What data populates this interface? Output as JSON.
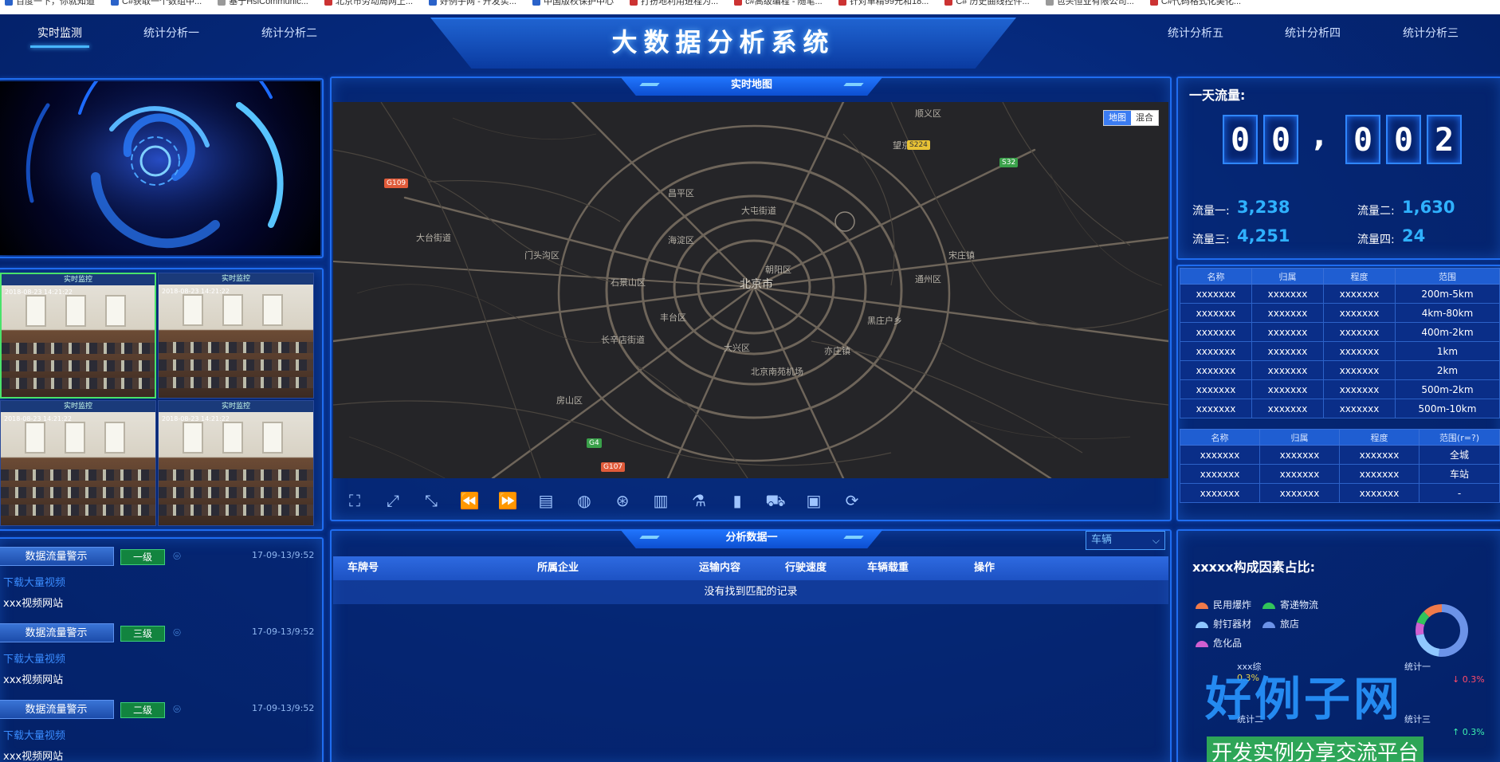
{
  "bookmarks": [
    "百度一下，你就知道",
    "C#获取一个数组中...",
    "基于HslCommunic...",
    "北京市劳动局网上...",
    "好例子网 - 开发实...",
    "中国版权保护中心",
    "打扮地利用进程为...",
    "c#高级编程 - 随笔...",
    "针对单精99元和18...",
    "C# 历史曲线控件...",
    "包头恒业有限公司...",
    "C#代码格式化美化..."
  ],
  "header": {
    "title": "大数据分析系统",
    "nav_left": [
      "实时监测",
      "统计分析一",
      "统计分析二"
    ],
    "nav_right": [
      "统计分析五",
      "统计分析四",
      "统计分析三"
    ]
  },
  "cameras": {
    "bar_label": "实时监控",
    "timestamp": "2018-08-23 14:21:22"
  },
  "alerts": [
    {
      "name": "数据流量警示",
      "level": "一级",
      "time": "17-09-13/9:52",
      "link": "下载大量视频",
      "site": "xxx视频网站"
    },
    {
      "name": "数据流量警示",
      "level": "三级",
      "time": "17-09-13/9:52",
      "link": "下载大量视频",
      "site": "xxx视频网站"
    },
    {
      "name": "数据流量警示",
      "level": "二级",
      "time": "17-09-13/9:52",
      "link": "下载大量视频",
      "site": "xxx视频网站"
    }
  ],
  "map": {
    "tab": "实时地图",
    "toggle": [
      "地图",
      "混合"
    ],
    "labels": {
      "center": "北京市",
      "l1": "昌平区",
      "l2": "海淀区",
      "l3": "朝阳区",
      "l4": "丰台区",
      "l5": "石景山区",
      "l6": "门头沟区",
      "l7": "通州区",
      "l8": "顺义区",
      "l9": "大兴区",
      "l10": "房山区",
      "l11": "长辛店街道",
      "l12": "大屯街道",
      "l13": "黑庄户乡",
      "l14": "北京南苑机场",
      "l15": "亦庄镇",
      "l16": "宋庄镇",
      "l17": "望京街道",
      "l18": "大台街道"
    },
    "roads": {
      "r1": "G109",
      "r2": "S224",
      "r3": "S32",
      "r4": "G4",
      "r5": "G107"
    }
  },
  "toolbar_icons": [
    "fullscreen-icon",
    "expand-icon",
    "collapse-icon",
    "rewind-icon",
    "forward-icon",
    "layers-icon",
    "globe-icon",
    "satellite-icon",
    "building-icon",
    "flask-icon",
    "chart-building-icon",
    "truck-icon",
    "window-icon",
    "refresh-icon"
  ],
  "analysis": {
    "tab": "分析数据一",
    "select_value": "车辆",
    "columns": [
      "车牌号",
      "所属企业",
      "运输内容",
      "行驶速度",
      "车辆载重",
      "操作"
    ],
    "empty": "没有找到匹配的记录"
  },
  "flow": {
    "title": "一天流量:",
    "digits": [
      "0",
      "0",
      "0",
      "0",
      "2"
    ],
    "sep": ",",
    "stats": [
      {
        "label": "流量一:",
        "value": "3,238"
      },
      {
        "label": "流量二:",
        "value": "1,630"
      },
      {
        "label": "流量三:",
        "value": "4,251"
      },
      {
        "label": "流量四:",
        "value": "24"
      }
    ]
  },
  "table1": {
    "headers": [
      "名称",
      "归属",
      "程度",
      "范围"
    ],
    "rows": [
      [
        "xxxxxxx",
        "xxxxxxx",
        "xxxxxxx",
        "200m-5km"
      ],
      [
        "xxxxxxx",
        "xxxxxxx",
        "xxxxxxx",
        "4km-80km"
      ],
      [
        "xxxxxxx",
        "xxxxxxx",
        "xxxxxxx",
        "400m-2km"
      ],
      [
        "xxxxxxx",
        "xxxxxxx",
        "xxxxxxx",
        "1km"
      ],
      [
        "xxxxxxx",
        "xxxxxxx",
        "xxxxxxx",
        "2km"
      ],
      [
        "xxxxxxx",
        "xxxxxxx",
        "xxxxxxx",
        "500m-2km"
      ],
      [
        "xxxxxxx",
        "xxxxxxx",
        "xxxxxxx",
        "500m-10km"
      ]
    ]
  },
  "table2": {
    "headers": [
      "名称",
      "归属",
      "程度",
      "范围(r=?)"
    ],
    "rows": [
      [
        "xxxxxxx",
        "xxxxxxx",
        "xxxxxxx",
        "全城"
      ],
      [
        "xxxxxxx",
        "xxxxxxx",
        "xxxxxxx",
        "车站"
      ],
      [
        "xxxxxxx",
        "xxxxxxx",
        "xxxxxxx",
        "-"
      ]
    ]
  },
  "factors": {
    "title": "xxxxx构成因素占比:",
    "legend": [
      {
        "name": "民用爆炸",
        "color": "#f07a4a"
      },
      {
        "name": "寄递物流",
        "color": "#32c45a"
      },
      {
        "name": "射钉器材",
        "color": "#8fc7ff"
      },
      {
        "name": "旅店",
        "color": "#6c93e8"
      },
      {
        "name": "危化品",
        "color": "#d05fd0"
      }
    ],
    "stats": [
      {
        "label": "xxx综",
        "pct": "0.3%"
      },
      {
        "label": "统计一",
        "pct": "↓ 0.3%"
      },
      {
        "label": "统计二",
        "pct": ""
      },
      {
        "label": "统计三",
        "pct": "↑ 0.3%"
      }
    ]
  },
  "watermark": {
    "big": "好例子网",
    "small": "开发实例分享交流平台"
  }
}
